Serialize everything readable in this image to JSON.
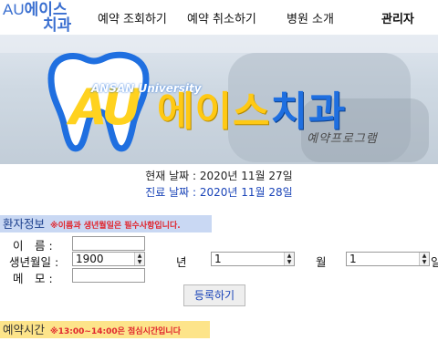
{
  "logo": {
    "line1_en": "AU",
    "line1_ko": "에이스",
    "line2": "치과"
  },
  "nav": {
    "items": [
      "예약 조회하기",
      "예약 취소하기",
      "병원 소개"
    ],
    "admin": "관리자"
  },
  "banner": {
    "tooth_letters": "AU",
    "university": "ANSAN University",
    "brand_yellow": "에이스",
    "brand_blue": "치과",
    "subtitle": "예약프로그램"
  },
  "dates": {
    "current": "현재 날짜 : 2020년 11월 27일",
    "treatment": "진료 날짜 : 2020년 11월 28일"
  },
  "patient_section": {
    "title": "환자정보",
    "notice": "※이름과 생년월일은 필수사항입니다.",
    "name_label": "이　름 :",
    "birth_label": "생년월일 :",
    "memo_label": "메　모 :",
    "name_value": "",
    "memo_value": "",
    "year_value": "1900",
    "year_unit": "년",
    "month_value": "1",
    "month_unit": "월",
    "day_value": "1",
    "day_unit": "일",
    "submit_label": "등록하기"
  },
  "time_section": {
    "title": "예약시간",
    "notice": "※13:00~14:00은 점심시간입니다"
  },
  "colors": {
    "accent_blue": "#1f6fe0",
    "accent_yellow": "#ffc914",
    "notice_red": "#e0262e",
    "section_blue": "#c9d8f3",
    "section_yellow": "#fde48a"
  }
}
